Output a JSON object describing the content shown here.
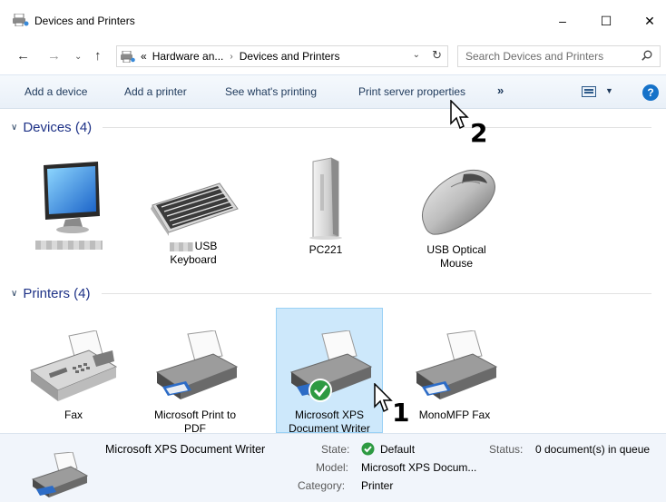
{
  "window": {
    "title": "Devices and Printers",
    "controls": {
      "minimize": "–",
      "maximize": "☐",
      "close": "✕"
    }
  },
  "address": {
    "nav": {
      "back": "←",
      "forward": "→",
      "recent": "⌄",
      "up": "↑"
    },
    "breadcrumb_prefix": "«",
    "crumbs": [
      "Hardware an...",
      "Devices and Printers"
    ],
    "separator": "›",
    "dropdown": "⌄",
    "refresh": "↻",
    "search_placeholder": "Search Devices and Printers"
  },
  "commands": {
    "items": [
      "Add a device",
      "Add a printer",
      "See what's printing",
      "Print server properties"
    ],
    "more": "»",
    "view_dropdown": "▼",
    "help": "?"
  },
  "groups": {
    "devices": {
      "title": "Devices (4)",
      "chevron": "∨",
      "items": [
        {
          "label": "",
          "icon": "monitor-icon",
          "redacted": true
        },
        {
          "label_suffix": "USB",
          "label2": "Keyboard",
          "icon": "keyboard-icon"
        },
        {
          "label": "PC221",
          "icon": "pc-tower-icon"
        },
        {
          "label": "USB Optical",
          "label2": "Mouse",
          "icon": "mouse-icon"
        }
      ]
    },
    "printers": {
      "title": "Printers (4)",
      "chevron": "∨",
      "items": [
        {
          "label": "Fax",
          "icon": "fax-icon"
        },
        {
          "label": "Microsoft Print to",
          "label2": "PDF",
          "icon": "printer-icon"
        },
        {
          "label": "Microsoft XPS",
          "label2": "Document Writer",
          "icon": "printer-default-icon",
          "selected": true
        },
        {
          "label": "MonoMFP Fax",
          "icon": "printer-icon"
        }
      ]
    }
  },
  "details": {
    "name": "Microsoft XPS Document Writer",
    "state_key": "State:",
    "state_value": "Default",
    "status_key": "Status:",
    "status_value": "0 document(s) in queue",
    "model_key": "Model:",
    "model_value": "Microsoft XPS Docum...",
    "category_key": "Category:",
    "category_value": "Printer"
  },
  "annotations": {
    "step1": "1",
    "step2": "2"
  },
  "colors": {
    "accent": "#1e3287",
    "selection": "#cde8fb",
    "command_text": "#1e395b"
  }
}
